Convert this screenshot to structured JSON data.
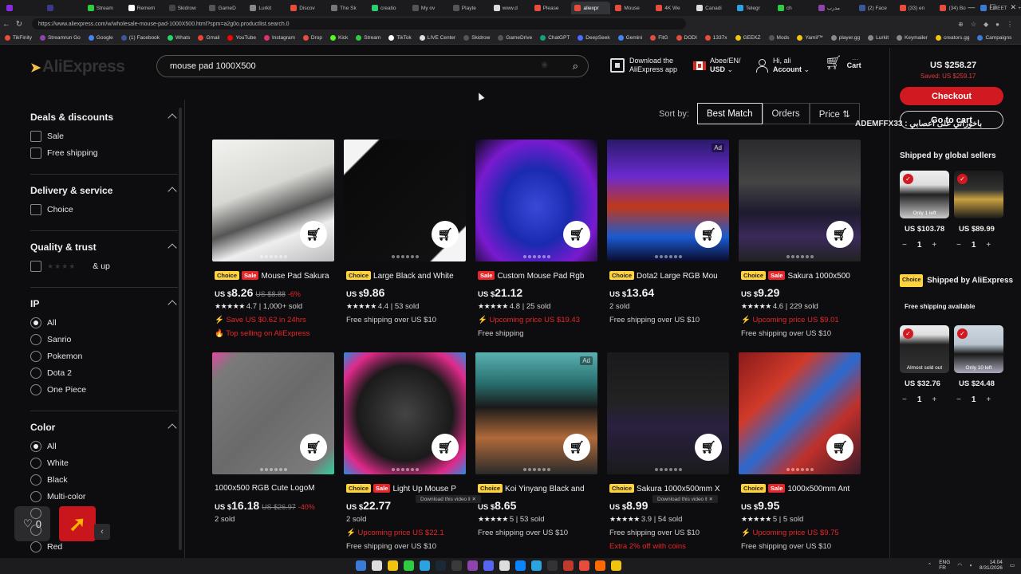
{
  "browser": {
    "tabs": [
      {
        "label": "",
        "color": "#8a2be2"
      },
      {
        "label": "",
        "color": "#3a3a8a"
      },
      {
        "label": "Stream",
        "color": "#2ecc40"
      },
      {
        "label": "Remem",
        "color": "#ffffff"
      },
      {
        "label": "Skidrow",
        "color": "#444444"
      },
      {
        "label": "GameD",
        "color": "#555555"
      },
      {
        "label": "Lurkit",
        "color": "#888888"
      },
      {
        "label": "Discov",
        "color": "#e74c3c"
      },
      {
        "label": "The Sk",
        "color": "#777777"
      },
      {
        "label": "creatio",
        "color": "#2ecc71"
      },
      {
        "label": "My ov",
        "color": "#555555"
      },
      {
        "label": "Playte",
        "color": "#555555"
      },
      {
        "label": "www.d",
        "color": "#dddddd"
      },
      {
        "label": "Please",
        "color": "#e74c3c"
      },
      {
        "label": "aliexpr",
        "color": "#e74c3c"
      },
      {
        "label": "Mouse",
        "color": "#e74c3c"
      },
      {
        "label": "4K We",
        "color": "#e74c3c"
      },
      {
        "label": "Canadi",
        "color": "#dddddd"
      },
      {
        "label": "Telegr",
        "color": "#2aa3e0"
      },
      {
        "label": "ch",
        "color": "#2ecc40"
      },
      {
        "label": "مدرب",
        "color": "#8e44ad"
      },
      {
        "label": "(2) Face",
        "color": "#3b5998"
      },
      {
        "label": "(33) en",
        "color": "#e74c3c"
      },
      {
        "label": "(34) Bo",
        "color": "#e74c3c"
      },
      {
        "label": "EMEET",
        "color": "#3a7bd5"
      }
    ],
    "active_tab_index": 14,
    "url": "https://www.aliexpress.com/w/wholesale-mouse-pad-1000X500.html?spm=a2g0o.productlist.search.0",
    "bookmarks": [
      {
        "label": "TikFinity",
        "color": "#e74c3c"
      },
      {
        "label": "Streamrun Go",
        "color": "#8e44ad"
      },
      {
        "label": "Google",
        "color": "#4285f4"
      },
      {
        "label": "(1) Facebook",
        "color": "#3b5998"
      },
      {
        "label": "Whats",
        "color": "#25d366"
      },
      {
        "label": "Gmail",
        "color": "#ea4335"
      },
      {
        "label": "YouTube",
        "color": "#ff0000"
      },
      {
        "label": "Instagram",
        "color": "#e1306c"
      },
      {
        "label": "Drop",
        "color": "#e74c3c"
      },
      {
        "label": "Kick",
        "color": "#53fc18"
      },
      {
        "label": "Stream",
        "color": "#2ecc40"
      },
      {
        "label": "TikTok",
        "color": "#ffffff"
      },
      {
        "label": "LIVE Center",
        "color": "#dddddd"
      },
      {
        "label": "Skidrow",
        "color": "#555555"
      },
      {
        "label": "GameDrive",
        "color": "#555555"
      },
      {
        "label": "ChatGPT",
        "color": "#10a37f"
      },
      {
        "label": "DeepSeek",
        "color": "#4d6bfe"
      },
      {
        "label": "Gemini",
        "color": "#4285f4"
      },
      {
        "label": "FitG",
        "color": "#e74c3c"
      },
      {
        "label": "DODI",
        "color": "#e74c3c"
      },
      {
        "label": "1337x",
        "color": "#e74c3c"
      },
      {
        "label": "GEEKZ",
        "color": "#f1c40f"
      },
      {
        "label": "Mods",
        "color": "#555555"
      },
      {
        "label": "Yamil™",
        "color": "#f1c40f"
      },
      {
        "label": "player.gg",
        "color": "#888888"
      },
      {
        "label": "Lurkit",
        "color": "#888888"
      },
      {
        "label": "Keymailer",
        "color": "#888888"
      },
      {
        "label": "creators.gg",
        "color": "#f1c40f"
      },
      {
        "label": "Campaigns",
        "color": "#3a7bd5"
      }
    ]
  },
  "header": {
    "logo_text": "AliExpress",
    "search_value": "mouse pad 1000X500",
    "download_app": [
      "Download the",
      "AliExpress app"
    ],
    "locale": [
      "Abee/EN/",
      "USD"
    ],
    "account": [
      "Hi, ali",
      "Account"
    ],
    "cart_label": "Cart",
    "cart_count": "···"
  },
  "filters": {
    "sections": [
      {
        "title": "Deals & discounts",
        "type": "checkbox",
        "options": [
          "Sale",
          "Free shipping"
        ]
      },
      {
        "title": "Delivery & service",
        "type": "checkbox",
        "options": [
          "Choice"
        ]
      },
      {
        "title": "Quality & trust",
        "type": "checkbox",
        "options": [
          "& up"
        ]
      },
      {
        "title": "IP",
        "type": "radio",
        "options": [
          "All",
          "Sanrio",
          "Pokemon",
          "Dota 2",
          "One Piece"
        ],
        "selected": "All"
      },
      {
        "title": "Color",
        "type": "radio",
        "options": [
          "All",
          "White",
          "Black",
          "Multi-color",
          "",
          "",
          "Red"
        ],
        "selected": "All"
      }
    ]
  },
  "sort": {
    "label": "Sort by:",
    "options": [
      "Best Match",
      "Orders",
      "Price ⇅"
    ],
    "active": "Best Match"
  },
  "products": [
    {
      "tags": [
        "Choice",
        "Sale"
      ],
      "title": "Mouse Pad Sakura",
      "cur": "US $",
      "price": "8.26",
      "old": "US $8.88",
      "off": "-6%",
      "rating": "4.7",
      "sold": "1,000+ sold",
      "lines": [
        {
          "text": "⚡ Save US $0.62 in 24hrs",
          "red": true
        },
        {
          "text": "🔥 Top selling on AliExpress",
          "red": true
        }
      ],
      "ad": false,
      "bg": "linear-gradient(160deg,#f2f2f0 0%,#d8d8d4 40%,#555 60%,#eee 75%,#bbb 100%)"
    },
    {
      "tags": [
        "Choice"
      ],
      "title": "Large Black and White",
      "cur": "US $",
      "price": "9.86",
      "old": "",
      "off": "",
      "rating": "4.4",
      "sold": "53 sold",
      "lines": [
        {
          "text": "Free shipping over US $10",
          "red": false
        }
      ],
      "ad": false,
      "bg": "linear-gradient(135deg,#f4f4f4 0%,#f4f4f4 14%,#0a0a0a 15%,#111 85%,#f4f4f4 86%)"
    },
    {
      "tags": [
        "Sale"
      ],
      "title": "Custom Mouse Pad Rgb",
      "cur": "US $",
      "price": "21.12",
      "old": "",
      "off": "",
      "rating": "4.8",
      "sold": "25 sold",
      "lines": [
        {
          "text": "⚡ Upcoming price US $19.43",
          "red": true
        },
        {
          "text": "Free shipping",
          "red": false
        }
      ],
      "ad": false,
      "bg": "radial-gradient(ellipse at 50% 55%,#3a4ad8 0%,#1a2ab0 40%,#7a1ad0 70%,#0a0a1a 100%)"
    },
    {
      "tags": [
        "Choice"
      ],
      "title": "Dota2 Large RGB Mou",
      "cur": "US $",
      "price": "13.64",
      "old": "",
      "off": "",
      "rating": "",
      "sold": "2 sold",
      "lines": [
        {
          "text": "Free shipping over US $10",
          "red": false
        }
      ],
      "ad": true,
      "bg": "linear-gradient(180deg,#2a1a6a 0%,#6a2ad0 30%,#c0381a 55%,#1a5ad0 80%,#0a0a2a 100%)"
    },
    {
      "tags": [
        "Choice",
        "Sale"
      ],
      "title": "Sakura 1000x500",
      "cur": "US $",
      "price": "9.29",
      "old": "",
      "off": "",
      "rating": "4.6",
      "sold": "229 sold",
      "lines": [
        {
          "text": "⚡ Upcoming price US $9.01",
          "red": true
        },
        {
          "text": "Free shipping over US $10",
          "red": false
        }
      ],
      "ad": false,
      "bg": "linear-gradient(180deg,#2a2a2e 0%,#444 35%,#1e1a2e 60%,#3a2a5a 80%,#222 100%)"
    },
    {
      "tags": [],
      "title": "1000x500 RGB Cute LogoM",
      "cur": "US $",
      "price": "16.18",
      "old": "US $26.97",
      "off": "-40%",
      "rating": "",
      "sold": "2 sold",
      "lines": [],
      "ad": false,
      "bg": "linear-gradient(135deg,#e04aa0 0%,#7a7a7a 12%,#6a6a6a 50%,#7a7a7a 88%,#30d0a0 100%)"
    },
    {
      "tags": [
        "Choice",
        "Sale"
      ],
      "title": "Light Up Mouse P",
      "cur": "US $",
      "price": "22.77",
      "old": "",
      "off": "",
      "rating": "",
      "sold": "2 sold",
      "lines": [
        {
          "text": "⚡ Upcoming price US $22.1",
          "red": true
        },
        {
          "text": "Free shipping over US $10",
          "red": false
        }
      ],
      "ad": false,
      "bg": "radial-gradient(ellipse at 50% 50%,#444 0%,#1a1a1a 55%,#e02a8a 80%,#2a8ae0 100%)"
    },
    {
      "tags": [
        "Choice"
      ],
      "title": "Koi Yinyang Black and",
      "cur": "US $",
      "price": "8.65",
      "old": "",
      "off": "",
      "rating": "5",
      "sold": "53 sold",
      "lines": [
        {
          "text": "Free shipping over US $10",
          "red": false
        }
      ],
      "ad": true,
      "bg": "linear-gradient(180deg,#5ab0b0 0%,#2a7070 25%,#1a1a1a 45%,#b06a3a 70%,#2a2a2a 100%)"
    },
    {
      "tags": [
        "Choice"
      ],
      "title": "Sakura 1000x500mm X",
      "cur": "US $",
      "price": "8.99",
      "old": "",
      "off": "",
      "rating": "3.9",
      "sold": "54 sold",
      "lines": [
        {
          "text": "Free shipping over US $10",
          "red": false
        },
        {
          "text": "Extra 2% off with coins",
          "red": true
        }
      ],
      "ad": false,
      "bg": "linear-gradient(180deg,#1a1a1c 0%,#222 40%,#2a2040 60%,#1a1a1c 100%)"
    },
    {
      "tags": [
        "Choice",
        "Sale"
      ],
      "title": "1000x500mm Ant",
      "cur": "US $",
      "price": "9.95",
      "old": "",
      "off": "",
      "rating": "5",
      "sold": "5 sold",
      "lines": [
        {
          "text": "⚡ Upcoming price US $9.75",
          "red": true
        },
        {
          "text": "Free shipping over US $10",
          "red": false
        }
      ],
      "ad": false,
      "bg": "linear-gradient(135deg,#8a1a1a 0%,#d03a2a 30%,#2a6ad0 50%,#c0302a 70%,#3a1a2a 100%)"
    }
  ],
  "summary": {
    "total": "US $258.27",
    "saved": "Saved: US $259.17",
    "checkout": "Checkout",
    "go_cart": "Go to cart",
    "ship_global": "Shipped by global sellers",
    "global_items": [
      {
        "price": "US $103.78",
        "qty": "1",
        "note": "Only 1 left",
        "bg": "linear-gradient(180deg,#eee 0%,#ddd 30%,#222 50%,#ccc 100%)"
      },
      {
        "price": "US $89.99",
        "qty": "1",
        "note": "",
        "bg": "linear-gradient(180deg,#1a1a1a 0%,#333 40%,#c8a040 60%,#1a1a1a 100%)"
      }
    ],
    "choice_tag": "Choice",
    "ship_choice": "Shipped by AliExpress",
    "free_ship": "Free shipping available",
    "choice_items": [
      {
        "price": "US $32.76",
        "qty": "1",
        "note": "Almost sold out",
        "bg": "linear-gradient(180deg,#eee 0%,#ddd 20%,#222 40%,#333 100%)"
      },
      {
        "price": "US $24.48",
        "qty": "1",
        "note": "Only 10 left",
        "bg": "linear-gradient(180deg,#cfd8e0 0%,#b8c4d0 40%,#1a1a1a 60%,#aab 100%)"
      }
    ]
  },
  "overlay_text": "ADEMFFX33 : باخوراتي على اعصابي",
  "download_video": "Download this video",
  "likes": "0",
  "taskbar": {
    "icons": [
      "#3a7bd5",
      "#dddddd",
      "#f1c40f",
      "#2ecc40",
      "#2aa3e0",
      "#1b2838",
      "#3a3a3a",
      "#8e44ad",
      "#5865f2",
      "#dddddd",
      "#0a84ff",
      "#2aa3e0",
      "#333333",
      "#c0392b",
      "#e74c3c",
      "#ff6a00",
      "#f1c40f"
    ],
    "lang": [
      "ENG",
      "FR"
    ],
    "time": [
      "14:04",
      "8/31/2026"
    ]
  }
}
